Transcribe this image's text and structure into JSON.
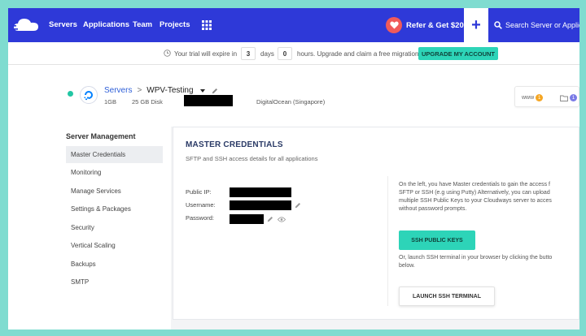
{
  "colors": {
    "brand": "#2e39d8",
    "accent": "#2dd4b8",
    "heart": "#f05a5a",
    "status": "#22c6a4"
  },
  "topnav": {
    "items": [
      "Servers",
      "Applications",
      "Team",
      "Projects"
    ],
    "refer_label": "Refer & Get $20",
    "plus_label": "+",
    "search_placeholder": "Search Server or Applic"
  },
  "trial": {
    "prefix": "Your trial will expire in",
    "days": "3",
    "days_label": "days",
    "hours": "0",
    "suffix": "hours. Upgrade and claim a free migration",
    "upgrade_label": "UPGRADE MY ACCOUNT"
  },
  "server": {
    "breadcrumb_root": "Servers",
    "separator": ">",
    "name": "WPV-Testing",
    "ram": "1GB",
    "disk": "25 GB Disk",
    "provider": "DigitalOcean (Singapore)",
    "www_label": "www",
    "www_count": "1",
    "folder_count": "1"
  },
  "sidebar": {
    "title": "Server Management",
    "items": [
      "Master Credentials",
      "Monitoring",
      "Manage Services",
      "Settings & Packages",
      "Security",
      "Vertical Scaling",
      "Backups",
      "SMTP"
    ]
  },
  "main": {
    "title": "MASTER CREDENTIALS",
    "subtitle": "SFTP and SSH access details for all applications",
    "labels": {
      "public_ip": "Public IP:",
      "username": "Username:",
      "password": "Password:"
    },
    "info_lines": [
      "On the left, you have Master credentials to gain the access f",
      "SFTP or SSH (e.g using Putty) Alternatively, you can upload",
      "multiple SSH Public Keys to your Cloudways server to acces",
      "without password prompts."
    ],
    "ssh_keys_label": "SSH PUBLIC KEYS",
    "terminal_lines": [
      "Or, launch SSH terminal in your browser by clicking the butto",
      "below."
    ],
    "launch_label": "LAUNCH SSH TERMINAL"
  }
}
